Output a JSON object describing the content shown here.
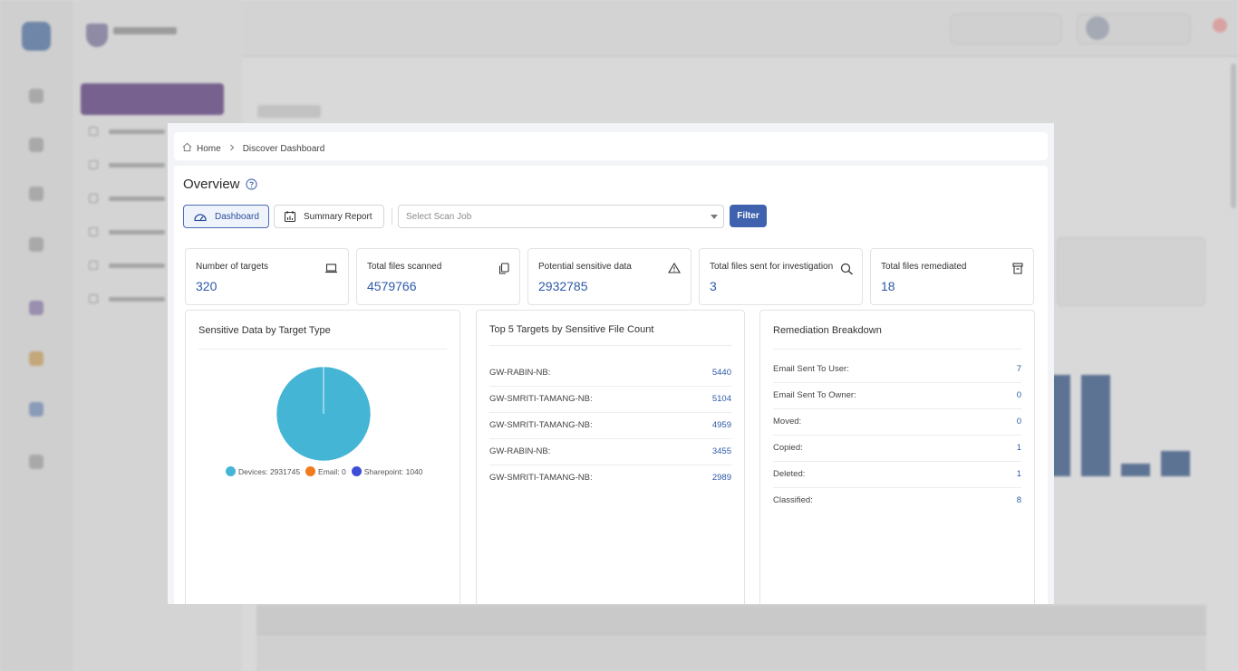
{
  "breadcrumb": {
    "home": "Home",
    "current": "Discover Dashboard"
  },
  "page": {
    "title": "Overview"
  },
  "toolbar": {
    "dashboard_label": "Dashboard",
    "summary_label": "Summary Report",
    "scan_job_placeholder": "Select Scan Job",
    "filter_label": "Filter"
  },
  "kpis": [
    {
      "label": "Number of targets",
      "value": "320",
      "icon": "laptop-icon"
    },
    {
      "label": "Total files scanned",
      "value": "4579766",
      "icon": "copy-icon"
    },
    {
      "label": "Potential sensitive data",
      "value": "2932785",
      "icon": "warning-icon"
    },
    {
      "label": "Total files sent for investigation",
      "value": "3",
      "icon": "search-icon"
    },
    {
      "label": "Total files remediated",
      "value": "18",
      "icon": "archive-icon"
    }
  ],
  "sensitive_by_target": {
    "title": "Sensitive Data by Target Type",
    "legend": [
      {
        "label": "Devices: 2931745",
        "color": "#45b5d6"
      },
      {
        "label": "Email: 0",
        "color": "#f07a1c"
      },
      {
        "label": "Sharepoint: 1040",
        "color": "#3f4ed6"
      }
    ]
  },
  "chart_data": {
    "type": "pie",
    "title": "Sensitive Data by Target Type",
    "categories": [
      "Devices",
      "Email",
      "Sharepoint"
    ],
    "values": [
      2931745,
      0,
      1040
    ],
    "colors": [
      "#45b5d6",
      "#f07a1c",
      "#3f4ed6"
    ]
  },
  "top_targets": {
    "title": "Top 5 Targets by Sensitive File Count",
    "rows": [
      {
        "name": "GW-RABIN-NB:",
        "value": "5440"
      },
      {
        "name": "GW-SMRITI-TAMANG-NB:",
        "value": "5104"
      },
      {
        "name": "GW-SMRITI-TAMANG-NB:",
        "value": "4959"
      },
      {
        "name": "GW-RABIN-NB:",
        "value": "3455"
      },
      {
        "name": "GW-SMRITI-TAMANG-NB:",
        "value": "2989"
      }
    ]
  },
  "remediation": {
    "title": "Remediation Breakdown",
    "rows": [
      {
        "name": "Email Sent To User:",
        "value": "7"
      },
      {
        "name": "Email Sent To Owner:",
        "value": "0"
      },
      {
        "name": "Moved:",
        "value": "0"
      },
      {
        "name": "Copied:",
        "value": "1"
      },
      {
        "name": "Deleted:",
        "value": "1"
      },
      {
        "name": "Classified:",
        "value": "8"
      }
    ]
  },
  "colors": {
    "accent": "#3e62ad",
    "value_blue": "#2d5aa8",
    "nav_active": "#77628f"
  }
}
